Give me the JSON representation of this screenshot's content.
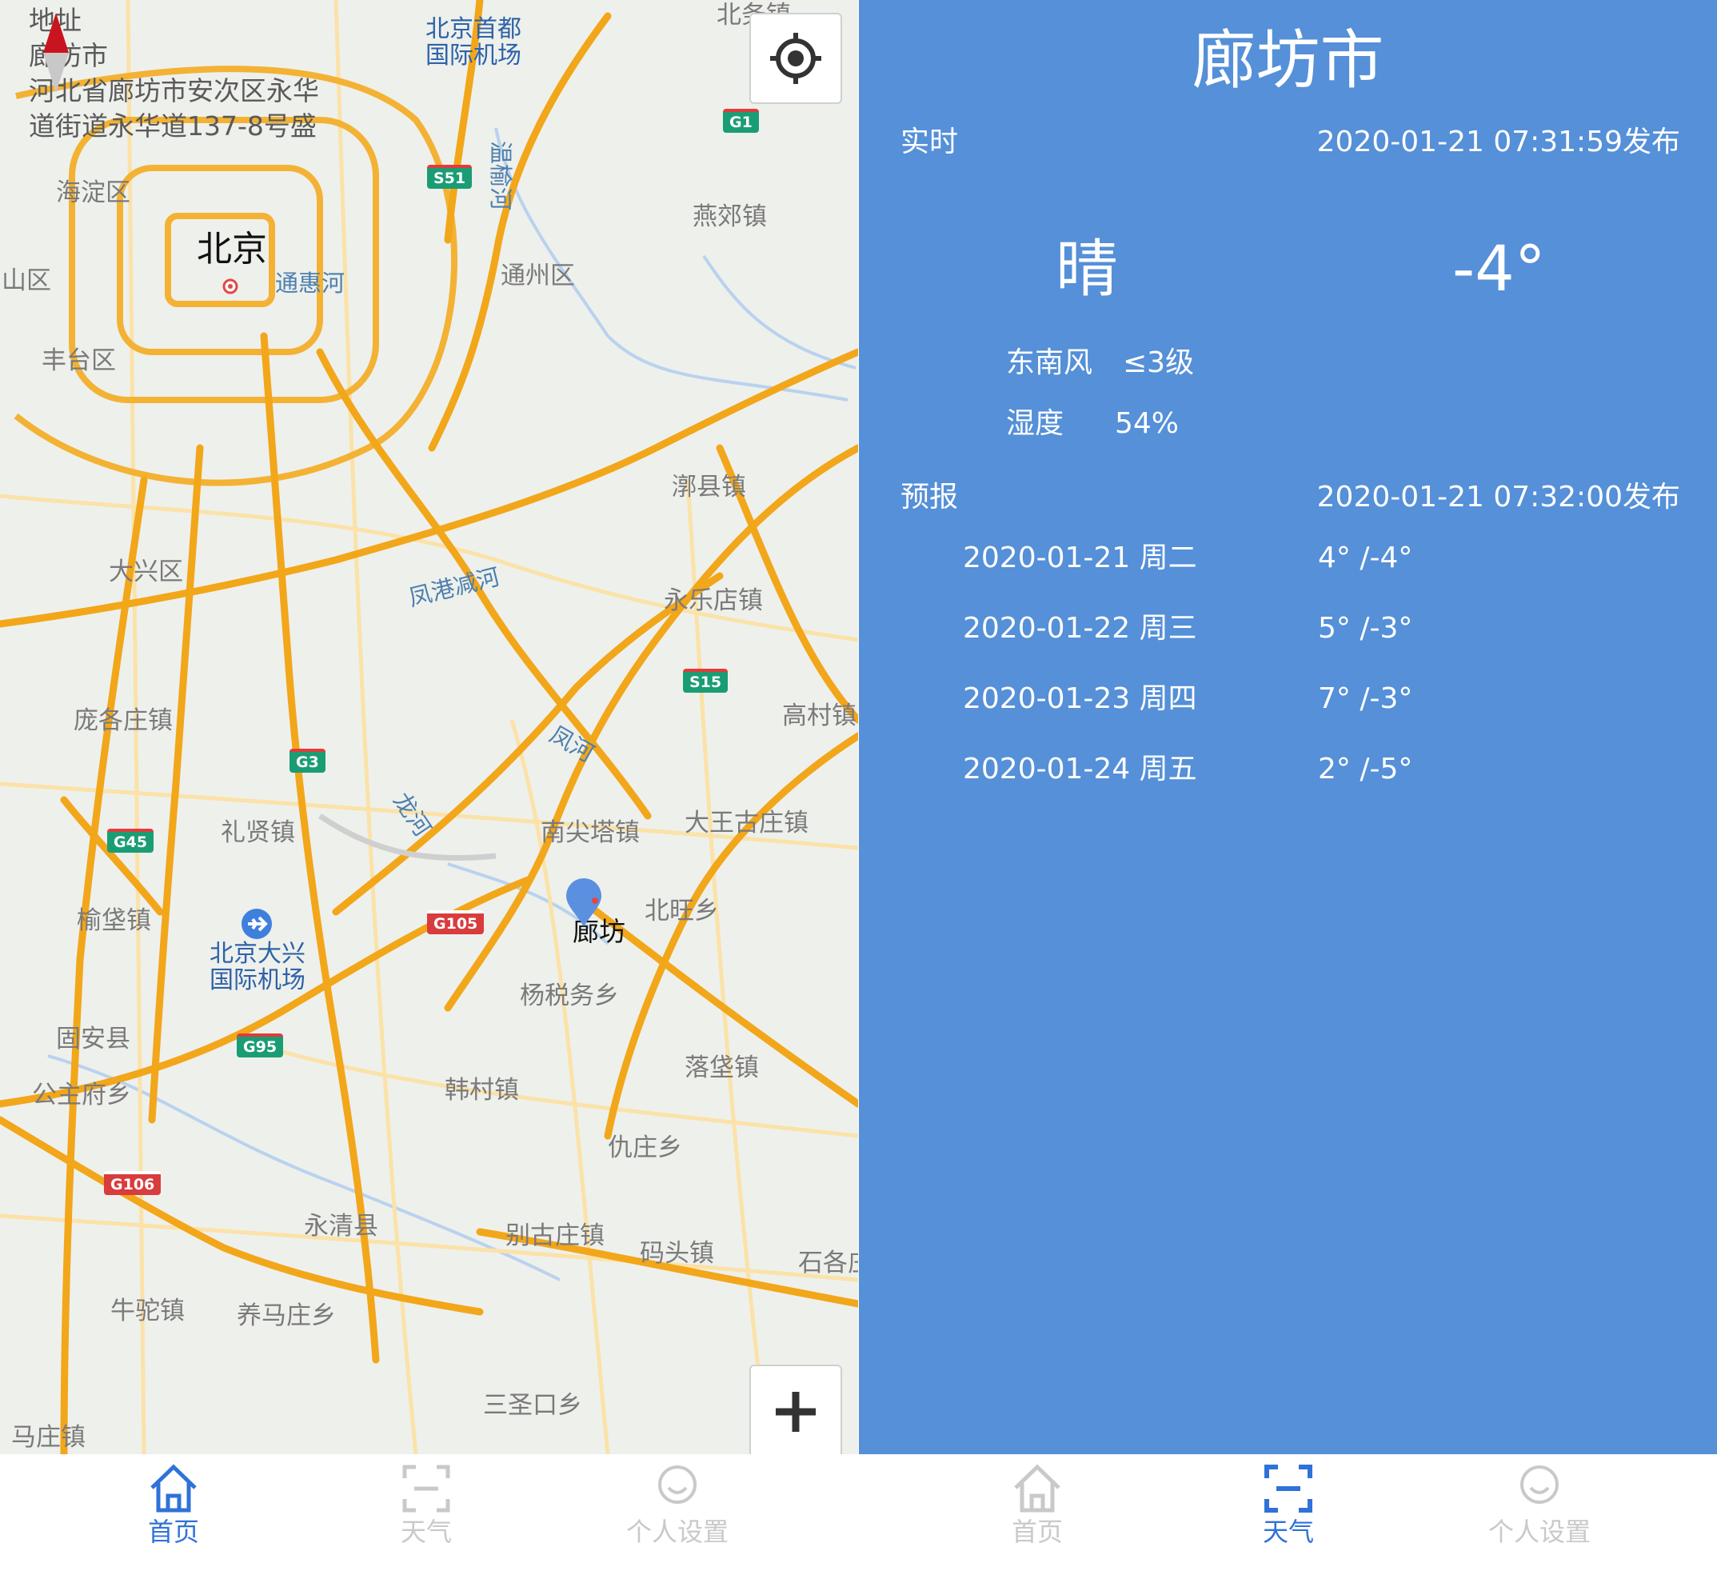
{
  "colors": {
    "accent": "#2f72d8",
    "weather_bg": "#5590d8",
    "road": "#f2a619",
    "inactive": "#c9c9c9"
  },
  "map_screen": {
    "address_overlay": {
      "lines": [
        "地址",
        "廊坊市",
        "河北省廊坊市安次区永华",
        "道街道永华道137-8号盛"
      ]
    },
    "places": {
      "beijing": "北京",
      "langfang": "廊坊",
      "haidian": "海淀区",
      "shijingshan": "山区",
      "fengtai": "丰台区",
      "tongzhou": "通州区",
      "daxing": "大兴区",
      "yanjiao": "燕郊镇",
      "beiwu": "北务镇",
      "shuxian": "漷县镇",
      "yongledian": "永乐店镇",
      "gaocun": "高村镇",
      "panggezhuang": "庞各庄镇",
      "lixian": "礼贤镇",
      "nanjianta": "南尖塔镇",
      "dawanggu": "大王古庄镇",
      "beiwang": "北旺乡",
      "yudian": "榆垡镇",
      "yangshuiwu": "杨税务乡",
      "guan": "固安县",
      "gongzhufu": "公主府乡",
      "hancun": "韩村镇",
      "luofa": "落垡镇",
      "qiuzhuang": "仇庄乡",
      "yongqing": "永清县",
      "biegu": "别古庄镇",
      "matou": "码头镇",
      "shige": "石各庄",
      "niutuo": "牛驼镇",
      "yangma": "养马庄乡",
      "sanshengkou": "三圣口乡",
      "mazhuang": "马庄镇"
    },
    "rivers": {
      "tonghui": "通惠河",
      "wenyu": "温榆河",
      "fenggang": "凤港减河",
      "feng": "凤河",
      "long": "龙河"
    },
    "airports": {
      "capital": "北京首都\n国际机场",
      "daxing": "北京大兴\n国际机场"
    },
    "highways": [
      "G1",
      "S51",
      "S15",
      "G3",
      "G45",
      "G105",
      "G95",
      "G106"
    ],
    "icons": {
      "locate": "locate-icon",
      "zoom_in": "plus-icon",
      "compass": "compass-icon",
      "pin": "location-pin-icon"
    }
  },
  "weather": {
    "city": "廊坊市",
    "realtime": {
      "label": "实时",
      "publish_time": "2020-01-21 07:31:59发布",
      "condition": "晴",
      "temperature": "-4°",
      "wind_direction": "东南风",
      "wind_level": "≤3级",
      "humidity_label": "湿度",
      "humidity_value": "54%"
    },
    "forecast": {
      "label": "预报",
      "publish_time": "2020-01-21 07:32:00发布",
      "days": [
        {
          "date": "2020-01-21  周二",
          "temp": "4° /-4°"
        },
        {
          "date": "2020-01-22  周三",
          "temp": "5° /-3°"
        },
        {
          "date": "2020-01-23  周四",
          "temp": "7° /-3°"
        },
        {
          "date": "2020-01-24  周五",
          "temp": "2° /-5°"
        }
      ]
    }
  },
  "nav_left": {
    "home": "首页",
    "weather": "天气",
    "settings": "个人设置",
    "active": "home"
  },
  "nav_right": {
    "home": "首页",
    "weather": "天气",
    "settings": "个人设置",
    "active": "weather"
  }
}
